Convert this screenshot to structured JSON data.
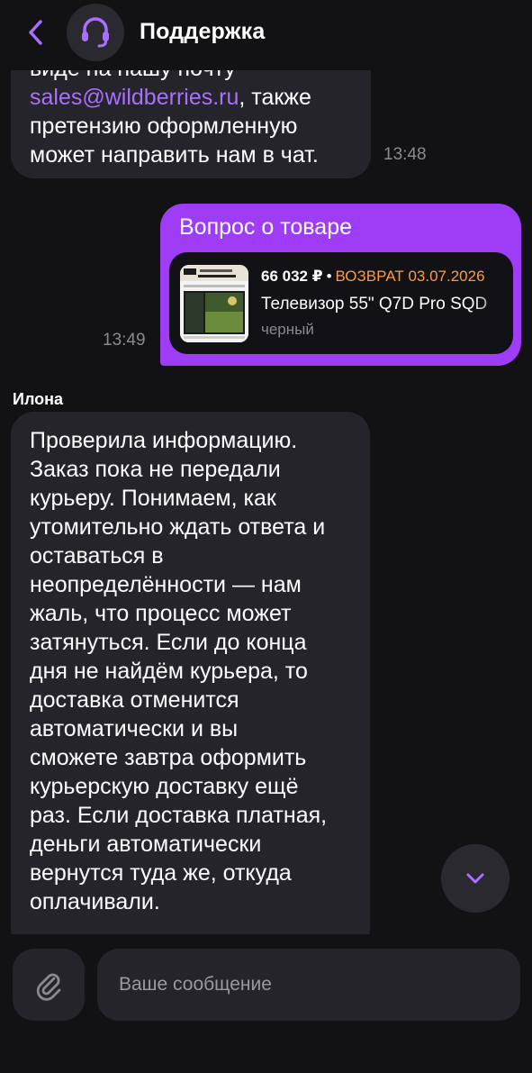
{
  "header": {
    "title": "Поддержка",
    "back_icon": "chevron-left-icon",
    "avatar_icon": "headset-icon",
    "accent_color": "#a970ff"
  },
  "messages": {
    "support_previous": {
      "line1": "виде на нашу почту",
      "email": "sales@wildberries.ru",
      "line2_rest": ", также",
      "line3": "претензию оформленную",
      "line4": "может направить нам в чат.",
      "time": "13:48"
    },
    "user_product": {
      "title": "Вопрос о товаре",
      "time": "13:49",
      "bubble_color": "#9f3cf5",
      "product": {
        "price": "66 032 ₽",
        "separator": "•",
        "return_label": "ВОЗВРАТ 03.07.2026",
        "name": "Телевизор 55\" Q7D Pro SQD",
        "color": "черный",
        "thumb_brand": "TCL",
        "thumb_model": "Телевизор 55\" Q7D Pro",
        "thumb_tech": "SQD-Mini LED UHD HDR",
        "return_color": "#ff9a3c"
      }
    },
    "support_reply": {
      "sender": "Илона",
      "text": "Проверила информацию.\nЗаказ пока не передали\nкурьеру. Понимаем, как\nутомительно ждать ответа и\nоставаться в\nнеопределённости — нам\nжаль, что процесс может\nзатянуться. Если до конца\nдня не найдём курьера, то\nдоставка отменится\nавтоматически и вы\nсможете завтра оформить\nкурьерскую доставку ещё\nраз. Если доставка платная,\nденьги автоматически\nвернутся туда же, откуда\nоплачивали."
    }
  },
  "scroll_button": {
    "icon": "chevron-down-icon"
  },
  "composer": {
    "placeholder": "Ваше сообщение",
    "attach_icon": "paperclip-icon"
  }
}
